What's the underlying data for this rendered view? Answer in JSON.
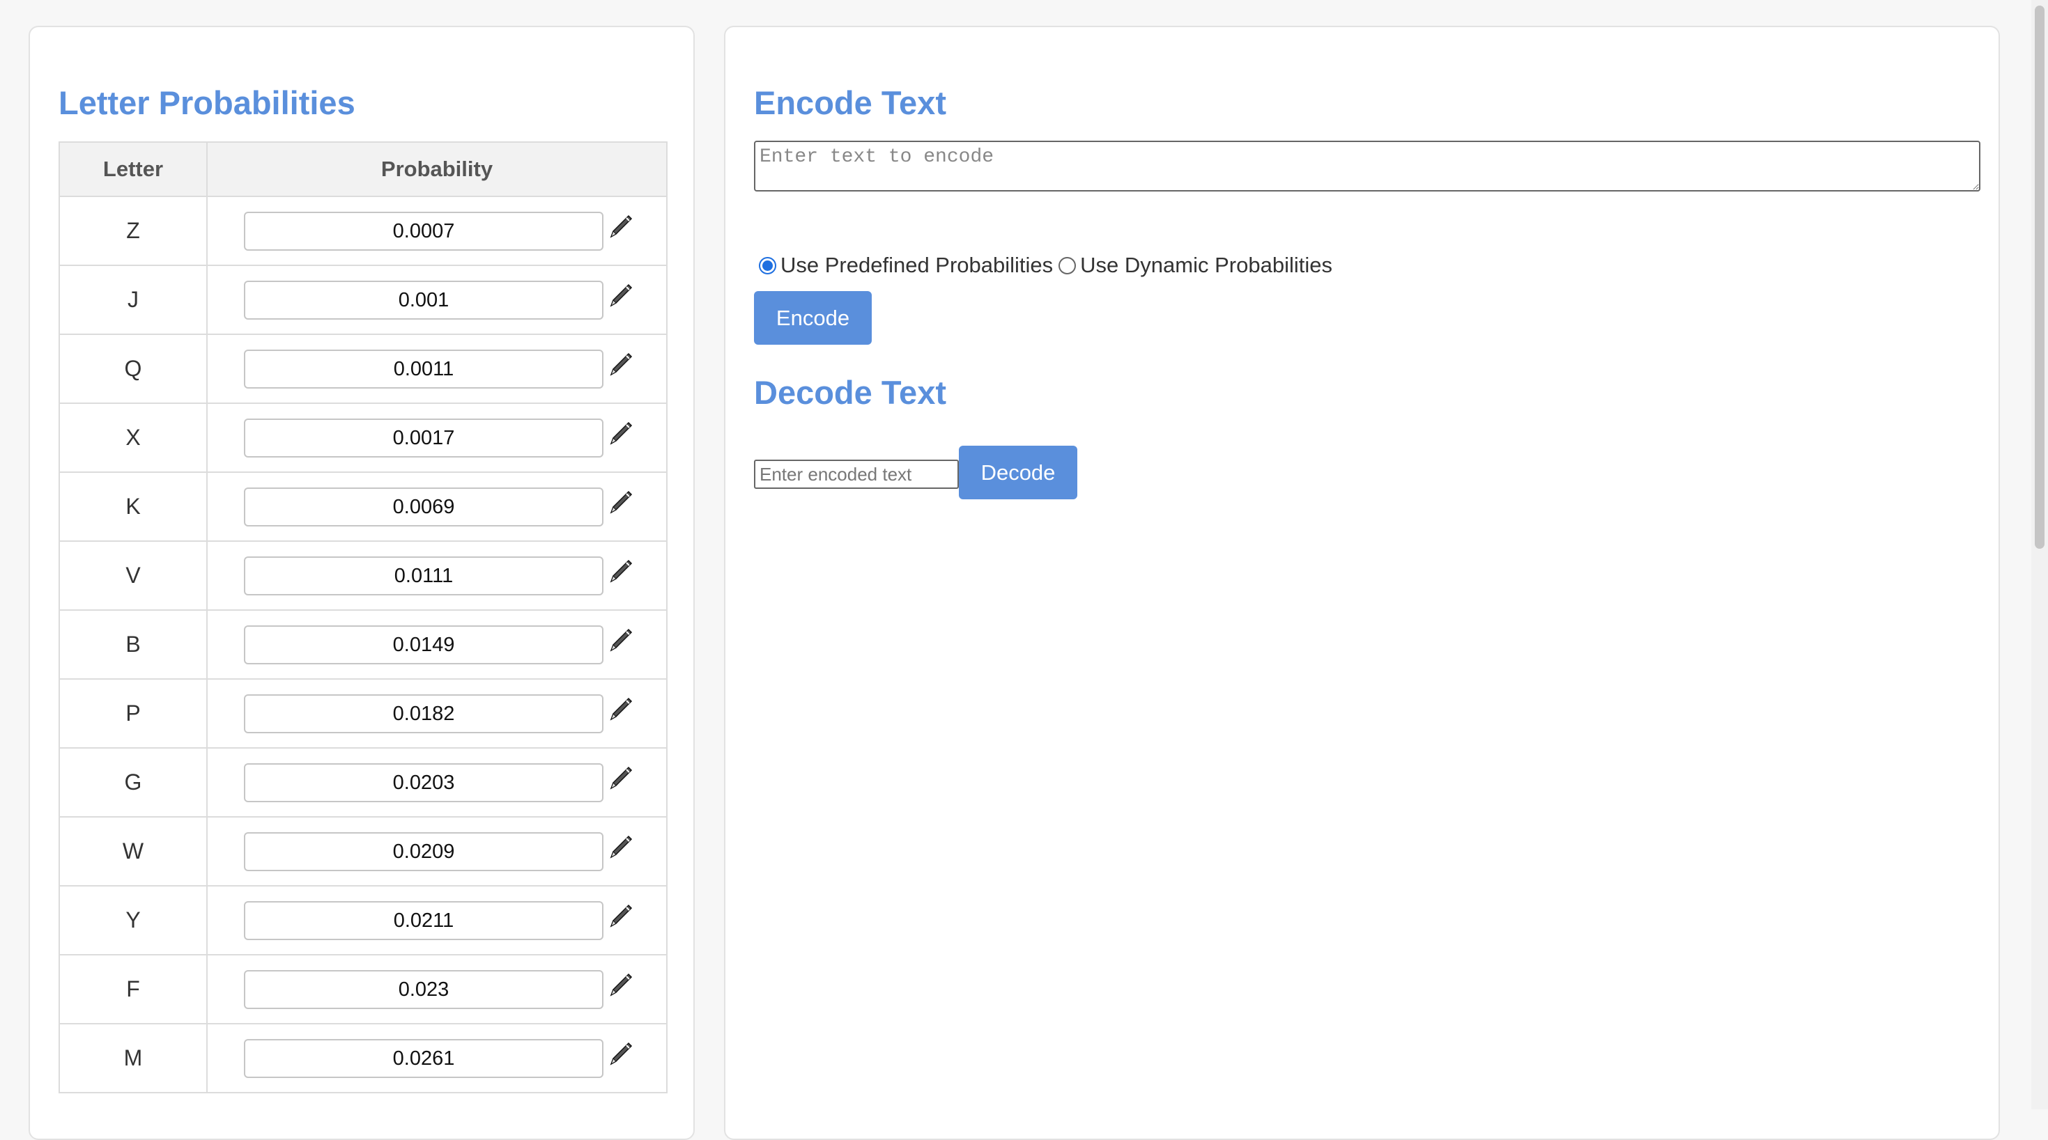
{
  "letter_panel": {
    "title": "Letter Probabilities",
    "columns": [
      "Letter",
      "Probability"
    ],
    "rows": [
      {
        "letter": "Z",
        "probability": "0.0007"
      },
      {
        "letter": "J",
        "probability": "0.001"
      },
      {
        "letter": "Q",
        "probability": "0.0011"
      },
      {
        "letter": "X",
        "probability": "0.0017"
      },
      {
        "letter": "K",
        "probability": "0.0069"
      },
      {
        "letter": "V",
        "probability": "0.0111"
      },
      {
        "letter": "B",
        "probability": "0.0149"
      },
      {
        "letter": "P",
        "probability": "0.0182"
      },
      {
        "letter": "G",
        "probability": "0.0203"
      },
      {
        "letter": "W",
        "probability": "0.0209"
      },
      {
        "letter": "Y",
        "probability": "0.0211"
      },
      {
        "letter": "F",
        "probability": "0.023"
      },
      {
        "letter": "M",
        "probability": "0.0261"
      }
    ],
    "edit_icon": "pencil-icon"
  },
  "encode": {
    "title": "Encode Text",
    "placeholder": "Enter text to encode",
    "value": "",
    "radio_options": [
      {
        "label": "Use Predefined Probabilities",
        "checked": true
      },
      {
        "label": "Use Dynamic Probabilities",
        "checked": false
      }
    ],
    "button_label": "Encode"
  },
  "decode": {
    "title": "Decode Text",
    "placeholder": "Enter encoded text",
    "value": "",
    "button_label": "Decode"
  },
  "colors": {
    "accent": "#5a8fdc",
    "radio_checked": "#1e6fe0"
  }
}
